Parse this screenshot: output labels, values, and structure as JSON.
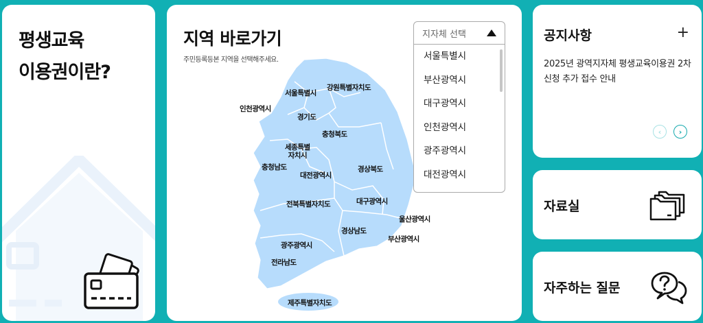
{
  "intro": {
    "title_line1": "평생교육",
    "title_line2": "이용권이란?"
  },
  "map": {
    "title": "지역 바로가기",
    "subtitle": "주민등록등본 지역을 선택해주세요.",
    "regions": {
      "gangwon": "강원특별자치도",
      "seoul": "서울특별시",
      "incheon": "인천광역시",
      "gyeonggi": "경기도",
      "chungbuk": "충청북도",
      "sejong_1": "세종특별",
      "sejong_2": "자치시",
      "chungnam": "충청남도",
      "gyeongbuk": "경상북도",
      "daejeon": "대전광역시",
      "jeonbuk": "전북특별자치도",
      "daegu": "대구광역시",
      "ulsan": "울산광역시",
      "gyeongnam": "경상남도",
      "busan": "부산광역시",
      "gwangju": "광주광역시",
      "jeonnam": "전라남도",
      "jeju": "제주특별자치도"
    },
    "map_fill": "#b7dcfc"
  },
  "dropdown": {
    "placeholder": "지자체 선택",
    "options": [
      "서울특별시",
      "부산광역시",
      "대구광역시",
      "인천광역시",
      "광주광역시",
      "대전광역시"
    ]
  },
  "notice": {
    "title": "공지사항",
    "plus": "+",
    "item": "2025년 광역지자체 평생교육이용권 2차 신청 추가 접수 안내",
    "prev": "‹",
    "next": "›"
  },
  "library": {
    "title": "자료실"
  },
  "faq": {
    "title": "자주하는 질문"
  },
  "colors": {
    "background": "#11b0b4",
    "accent": "#14a9ad",
    "map": "#b7dcfc"
  }
}
